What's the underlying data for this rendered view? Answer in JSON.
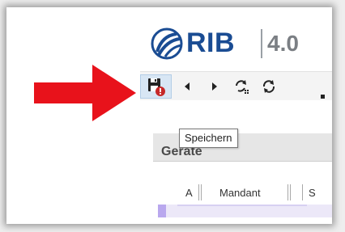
{
  "brand": {
    "name": "RIB",
    "version": "4.0",
    "color": "#1a4c93"
  },
  "toolbar": {
    "icons": [
      "save-icon",
      "error-badge-icon",
      "previous-icon",
      "next-icon",
      "sync-icon",
      "refresh-icon"
    ],
    "active_color": "#d8e6f4"
  },
  "tooltip": {
    "text": "Speichern"
  },
  "annotation": {
    "arrow_color": "#e8121b"
  },
  "panel": {
    "title": "Geräte",
    "columns": [
      "A",
      "Mandant",
      "S"
    ]
  }
}
